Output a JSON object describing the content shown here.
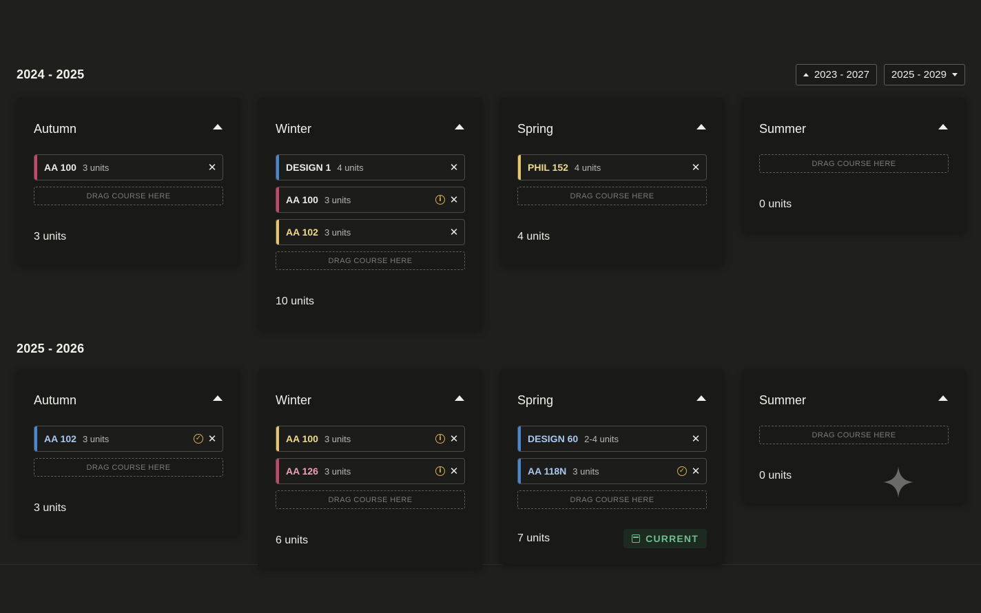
{
  "range_selector": {
    "first_label": "2023 - 2027",
    "second_label": "2025 - 2029"
  },
  "years": [
    {
      "title": "2024 - 2025",
      "quarters": [
        {
          "name": "Autumn",
          "courses": [
            {
              "code": "AA 100",
              "units": "3 units",
              "color": "#c8466b",
              "code_color": "#ecebe6",
              "status": ""
            }
          ],
          "dropzone": "DRAG COURSE HERE",
          "total": "3 units"
        },
        {
          "name": "Winter",
          "courses": [
            {
              "code": "DESIGN 1",
              "units": "4 units",
              "color": "#4a87d2",
              "code_color": "#ecebe6",
              "status": ""
            },
            {
              "code": "AA 100",
              "units": "3 units",
              "color": "#c8466b",
              "code_color": "#ecebe6",
              "status": "warning"
            },
            {
              "code": "AA 102",
              "units": "3 units",
              "color": "#e7c765",
              "code_color": "#f1d98a",
              "status": ""
            }
          ],
          "dropzone": "DRAG COURSE HERE",
          "total": "10 units"
        },
        {
          "name": "Spring",
          "courses": [
            {
              "code": "PHIL 152",
              "units": "4 units",
              "color": "#e7c765",
              "code_color": "#f1d98a",
              "status": ""
            }
          ],
          "dropzone": "DRAG COURSE HERE",
          "total": "4 units"
        },
        {
          "name": "Summer",
          "courses": [],
          "dropzone": "DRAG COURSE HERE",
          "total": "0 units"
        }
      ]
    },
    {
      "title": "2025 - 2026",
      "quarters": [
        {
          "name": "Autumn",
          "courses": [
            {
              "code": "AA 102",
              "units": "3 units",
              "color": "#4a87d2",
              "code_color": "#a9c8ee",
              "status": "check"
            }
          ],
          "dropzone": "DRAG COURSE HERE",
          "total": "3 units"
        },
        {
          "name": "Winter",
          "courses": [
            {
              "code": "AA 100",
              "units": "3 units",
              "color": "#e7c765",
              "code_color": "#f1d98a",
              "status": "warning"
            },
            {
              "code": "AA 126",
              "units": "3 units",
              "color": "#c8466b",
              "code_color": "#eaa3b6",
              "status": "warning"
            }
          ],
          "dropzone": "DRAG COURSE HERE",
          "total": "6 units"
        },
        {
          "name": "Spring",
          "courses": [
            {
              "code": "DESIGN 60",
              "units": "2-4 units",
              "color": "#4a87d2",
              "code_color": "#a9c8ee",
              "status": ""
            },
            {
              "code": "AA 118N",
              "units": "3 units",
              "color": "#4a87d2",
              "code_color": "#a9c8ee",
              "status": "check"
            }
          ],
          "dropzone": "DRAG COURSE HERE",
          "total": "7 units",
          "badge": "CURRENT"
        },
        {
          "name": "Summer",
          "courses": [],
          "dropzone": "DRAG COURSE HERE",
          "total": "0 units"
        }
      ]
    }
  ],
  "colors": {
    "background": "#1f1f1e",
    "card": "#191918",
    "accent_red": "#c8466b",
    "accent_blue": "#4a87d2",
    "accent_yellow": "#e7c765",
    "warning": "#d9b24b",
    "current_green": "#6fbf8a"
  },
  "icons": {
    "collapse": "chevron-up-icon",
    "remove": "close-icon",
    "warning": "info-circle-icon",
    "check": "check-circle-icon",
    "current": "calendar-icon"
  }
}
